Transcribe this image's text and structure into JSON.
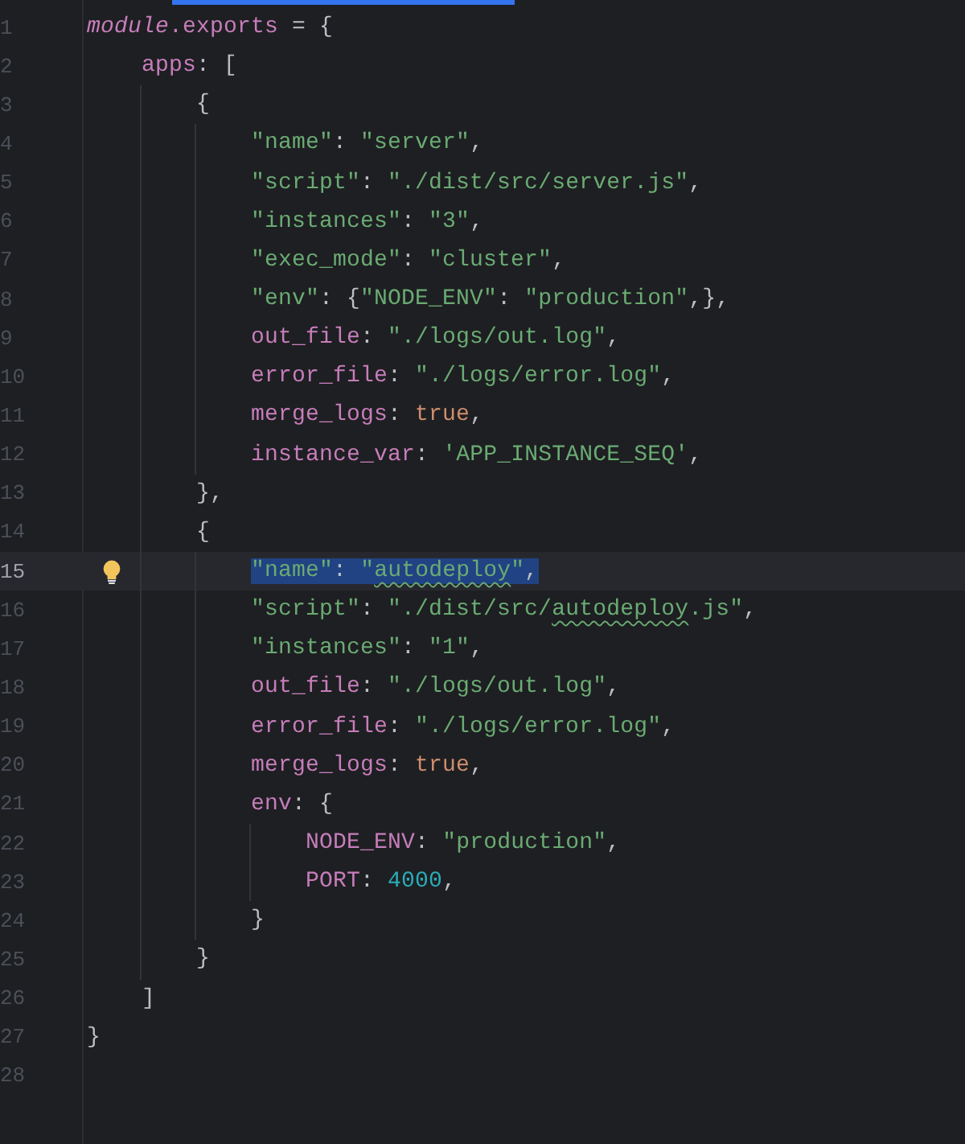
{
  "editor": {
    "lines": [
      {
        "number": "1",
        "tokens": [
          {
            "kind": "italic",
            "text": "module"
          },
          {
            "kind": "key",
            "text": ".exports"
          },
          {
            "kind": "punct",
            "text": " = {"
          }
        ]
      },
      {
        "number": "2",
        "tokens": [
          {
            "kind": "key",
            "text": "    apps"
          },
          {
            "kind": "punct",
            "text": ": ["
          }
        ]
      },
      {
        "number": "3",
        "tokens": [
          {
            "kind": "punct",
            "text": "        {"
          }
        ]
      },
      {
        "number": "4",
        "tokens": [
          {
            "kind": "string",
            "text": "            \"name\""
          },
          {
            "kind": "punct",
            "text": ": "
          },
          {
            "kind": "string",
            "text": "\"server\""
          },
          {
            "kind": "punct",
            "text": ","
          }
        ]
      },
      {
        "number": "5",
        "tokens": [
          {
            "kind": "string",
            "text": "            \"script\""
          },
          {
            "kind": "punct",
            "text": ": "
          },
          {
            "kind": "string",
            "text": "\"./dist/src/server.js\""
          },
          {
            "kind": "punct",
            "text": ","
          }
        ]
      },
      {
        "number": "6",
        "tokens": [
          {
            "kind": "string",
            "text": "            \"instances\""
          },
          {
            "kind": "punct",
            "text": ": "
          },
          {
            "kind": "string",
            "text": "\"3\""
          },
          {
            "kind": "punct",
            "text": ","
          }
        ]
      },
      {
        "number": "7",
        "tokens": [
          {
            "kind": "string",
            "text": "            \"exec_mode\""
          },
          {
            "kind": "punct",
            "text": ": "
          },
          {
            "kind": "string",
            "text": "\"cluster\""
          },
          {
            "kind": "punct",
            "text": ","
          }
        ]
      },
      {
        "number": "8",
        "tokens": [
          {
            "kind": "string",
            "text": "            \"env\""
          },
          {
            "kind": "punct",
            "text": ": {"
          },
          {
            "kind": "string",
            "text": "\"NODE_ENV\""
          },
          {
            "kind": "punct",
            "text": ": "
          },
          {
            "kind": "string",
            "text": "\"production\""
          },
          {
            "kind": "punct",
            "text": ",},"
          }
        ]
      },
      {
        "number": "9",
        "tokens": [
          {
            "kind": "key",
            "text": "            out_file"
          },
          {
            "kind": "punct",
            "text": ": "
          },
          {
            "kind": "string",
            "text": "\"./logs/out.log\""
          },
          {
            "kind": "punct",
            "text": ","
          }
        ]
      },
      {
        "number": "10",
        "tokens": [
          {
            "kind": "key",
            "text": "            error_file"
          },
          {
            "kind": "punct",
            "text": ": "
          },
          {
            "kind": "string",
            "text": "\"./logs/error.log\""
          },
          {
            "kind": "punct",
            "text": ","
          }
        ]
      },
      {
        "number": "11",
        "tokens": [
          {
            "kind": "key",
            "text": "            merge_logs"
          },
          {
            "kind": "punct",
            "text": ": "
          },
          {
            "kind": "keyword",
            "text": "true"
          },
          {
            "kind": "punct",
            "text": ","
          }
        ]
      },
      {
        "number": "12",
        "tokens": [
          {
            "kind": "key",
            "text": "            instance_var"
          },
          {
            "kind": "punct",
            "text": ": "
          },
          {
            "kind": "string",
            "text": "'APP_INSTANCE_SEQ'"
          },
          {
            "kind": "punct",
            "text": ","
          }
        ]
      },
      {
        "number": "13",
        "tokens": [
          {
            "kind": "punct",
            "text": "        },"
          }
        ]
      },
      {
        "number": "14",
        "tokens": [
          {
            "kind": "punct",
            "text": "        {"
          }
        ]
      },
      {
        "number": "15",
        "current": true,
        "intention": true,
        "tokens": [
          {
            "kind": "string",
            "text": "            \"name\"",
            "selected": true
          },
          {
            "kind": "punct",
            "text": ": ",
            "selected": true
          },
          {
            "kind": "string",
            "text": "\"",
            "selected": true
          },
          {
            "kind": "string",
            "text": "autodeploy",
            "selected": true,
            "warning": true
          },
          {
            "kind": "string",
            "text": "\"",
            "selected": true
          },
          {
            "kind": "punct",
            "text": ",",
            "selected": true
          }
        ]
      },
      {
        "number": "16",
        "tokens": [
          {
            "kind": "string",
            "text": "            \"script\""
          },
          {
            "kind": "punct",
            "text": ": "
          },
          {
            "kind": "string",
            "text": "\"./dist/src/"
          },
          {
            "kind": "string",
            "text": "autodeploy",
            "warning": true
          },
          {
            "kind": "string",
            "text": ".js\""
          },
          {
            "kind": "punct",
            "text": ","
          }
        ]
      },
      {
        "number": "17",
        "tokens": [
          {
            "kind": "string",
            "text": "            \"instances\""
          },
          {
            "kind": "punct",
            "text": ": "
          },
          {
            "kind": "string",
            "text": "\"1\""
          },
          {
            "kind": "punct",
            "text": ","
          }
        ]
      },
      {
        "number": "18",
        "tokens": [
          {
            "kind": "key",
            "text": "            out_file"
          },
          {
            "kind": "punct",
            "text": ": "
          },
          {
            "kind": "string",
            "text": "\"./logs/out.log\""
          },
          {
            "kind": "punct",
            "text": ","
          }
        ]
      },
      {
        "number": "19",
        "tokens": [
          {
            "kind": "key",
            "text": "            error_file"
          },
          {
            "kind": "punct",
            "text": ": "
          },
          {
            "kind": "string",
            "text": "\"./logs/error.log\""
          },
          {
            "kind": "punct",
            "text": ","
          }
        ]
      },
      {
        "number": "20",
        "tokens": [
          {
            "kind": "key",
            "text": "            merge_logs"
          },
          {
            "kind": "punct",
            "text": ": "
          },
          {
            "kind": "keyword",
            "text": "true"
          },
          {
            "kind": "punct",
            "text": ","
          }
        ]
      },
      {
        "number": "21",
        "tokens": [
          {
            "kind": "key",
            "text": "            env"
          },
          {
            "kind": "punct",
            "text": ": {"
          }
        ]
      },
      {
        "number": "22",
        "tokens": [
          {
            "kind": "key",
            "text": "                NODE_ENV"
          },
          {
            "kind": "punct",
            "text": ": "
          },
          {
            "kind": "string",
            "text": "\"production\""
          },
          {
            "kind": "punct",
            "text": ","
          }
        ]
      },
      {
        "number": "23",
        "tokens": [
          {
            "kind": "key",
            "text": "                PORT"
          },
          {
            "kind": "punct",
            "text": ": "
          },
          {
            "kind": "number",
            "text": "4000"
          },
          {
            "kind": "punct",
            "text": ","
          }
        ]
      },
      {
        "number": "24",
        "tokens": [
          {
            "kind": "punct",
            "text": "            }"
          }
        ]
      },
      {
        "number": "25",
        "tokens": [
          {
            "kind": "punct",
            "text": "        }"
          }
        ]
      },
      {
        "number": "26",
        "tokens": [
          {
            "kind": "punct",
            "text": "    ]"
          }
        ]
      },
      {
        "number": "27",
        "tokens": [
          {
            "kind": "punct",
            "text": "}"
          }
        ]
      },
      {
        "number": "28"
      }
    ]
  }
}
